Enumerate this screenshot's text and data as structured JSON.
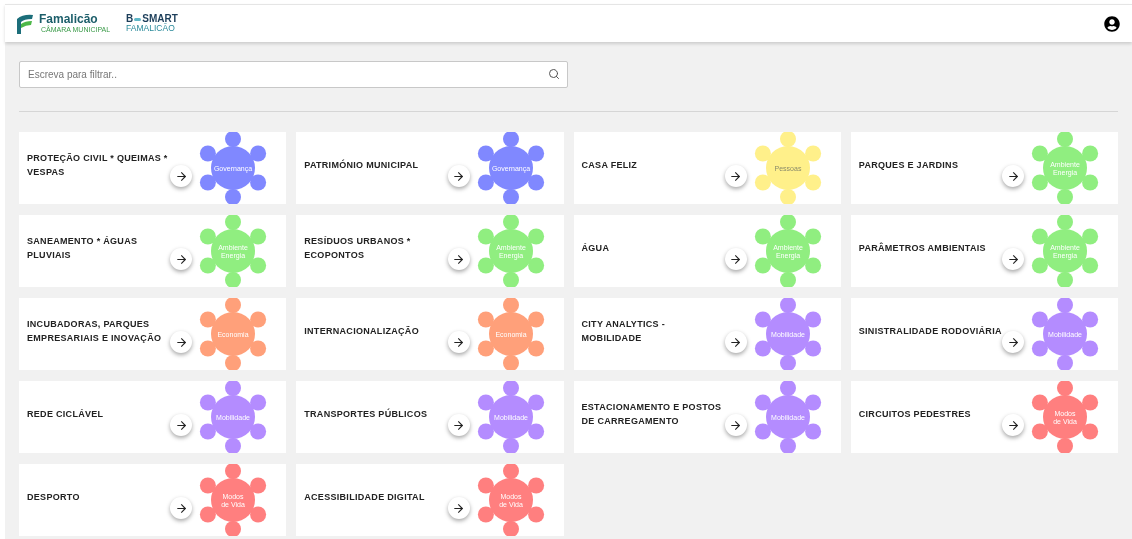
{
  "header": {
    "logo": {
      "name": "Famalicão",
      "subtitle": "CÂMARA MUNICIPAL"
    },
    "brand": {
      "prefix": "B",
      "name": "SMART",
      "city": "FAMALICÃO"
    }
  },
  "search": {
    "placeholder": "Escreva para filtrar.."
  },
  "cards": [
    {
      "title": "PROTEÇÃO CIVIL * QUEIMAS * VESPAS",
      "category": [
        "Governança"
      ],
      "color": "#8088ff"
    },
    {
      "title": "PATRIMÓNIO MUNICIPAL",
      "category": [
        "Governança"
      ],
      "color": "#8088ff"
    },
    {
      "title": "CASA FELIZ",
      "category": [
        "Pessoas"
      ],
      "color": "#fff08a"
    },
    {
      "title": "PARQUES E JARDINS",
      "category": [
        "Ambiente",
        "Energia"
      ],
      "color": "#90ee80"
    },
    {
      "title": "SANEAMENTO * ÁGUAS PLUVIAIS",
      "category": [
        "Ambiente",
        "Energia"
      ],
      "color": "#90ee80"
    },
    {
      "title": "RESÍDUOS URBANOS * ECOPONTOS",
      "category": [
        "Ambiente",
        "Energia"
      ],
      "color": "#90ee80"
    },
    {
      "title": "ÁGUA",
      "category": [
        "Ambiente",
        "Energia"
      ],
      "color": "#90ee80"
    },
    {
      "title": "PARÂMETROS AMBIENTAIS",
      "category": [
        "Ambiente",
        "Energia"
      ],
      "color": "#90ee80"
    },
    {
      "title": "INCUBADORAS, PARQUES EMPRESARIAIS E INOVAÇÃO",
      "category": [
        "Economia"
      ],
      "color": "#ffa07a"
    },
    {
      "title": "INTERNACIONALIZAÇÃO",
      "category": [
        "Economia"
      ],
      "color": "#ffa07a"
    },
    {
      "title": "CITY ANALYTICS - MOBILIDADE",
      "category": [
        "Mobilidade"
      ],
      "color": "#b48cff"
    },
    {
      "title": "SINISTRALIDADE RODOVIÁRIA",
      "category": [
        "Mobilidade"
      ],
      "color": "#b48cff"
    },
    {
      "title": "REDE CICLÁVEL",
      "category": [
        "Mobilidade"
      ],
      "color": "#b48cff"
    },
    {
      "title": "TRANSPORTES PÚBLICOS",
      "category": [
        "Mobilidade"
      ],
      "color": "#b48cff"
    },
    {
      "title": "ESTACIONAMENTO E POSTOS DE CARREGAMENTO",
      "category": [
        "Mobilidade"
      ],
      "color": "#b48cff"
    },
    {
      "title": "CIRCUITOS PEDESTRES",
      "category": [
        "Modos",
        "de Vida"
      ],
      "color": "#ff7f7f"
    },
    {
      "title": "DESPORTO",
      "category": [
        "Modos",
        "de Vida"
      ],
      "color": "#ff7f7f"
    },
    {
      "title": "ACESSIBILIDADE DIGITAL",
      "category": [
        "Modos",
        "de Vida"
      ],
      "color": "#ff7f7f"
    }
  ]
}
